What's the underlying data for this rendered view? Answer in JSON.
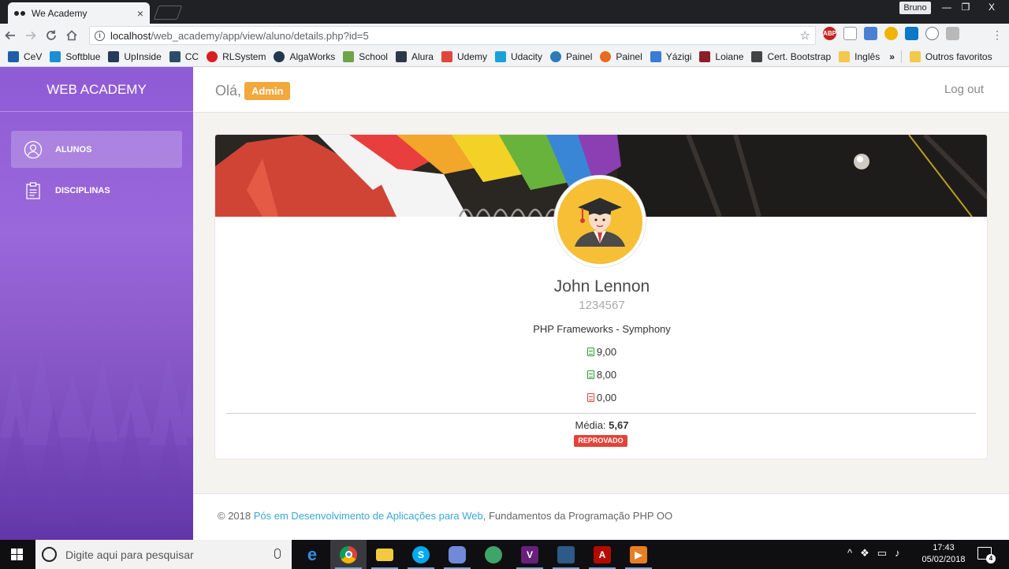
{
  "browser": {
    "tab_title": "We Academy",
    "tab_close": "×",
    "user_name": "Bruno",
    "window_min": "—",
    "window_max": "❐",
    "window_close": "X",
    "url_host": "localhost",
    "url_path": "/web_academy/app/view/aluno/details.php?id=5",
    "bookmarks": [
      "CeV",
      "Softblue",
      "UpInside",
      "CC",
      "RLSystem",
      "AlgaWorks",
      "School",
      "Alura",
      "Udemy",
      "Udacity",
      "Painel",
      "Painel",
      "Yázigi",
      "Loiane",
      "Cert. Bootstrap",
      "Inglês"
    ],
    "bookmarks_more": "»",
    "bookmarks_other": "Outros favoritos",
    "colors": {
      "titlebar": "#202124",
      "toolbar": "#f1f3f4"
    }
  },
  "sidebar": {
    "brand": "WEB ACADEMY",
    "items": [
      {
        "label": "ALUNOS",
        "icon": "user-circle-icon",
        "active": true
      },
      {
        "label": "DISCIPLINAS",
        "icon": "clipboard-icon",
        "active": false
      }
    ],
    "colors": {
      "top": "#8f5bd6",
      "bottom": "#6b3fb2"
    }
  },
  "header": {
    "greeting": "Olá,",
    "user_badge": "Admin",
    "logout": "Log out"
  },
  "student": {
    "name": "John Lennon",
    "registration": "1234567",
    "course": "PHP Frameworks - Symphony",
    "grades": [
      {
        "value": "9,00",
        "status": "ok"
      },
      {
        "value": "8,00",
        "status": "ok"
      },
      {
        "value": "0,00",
        "status": "bad"
      }
    ],
    "average_label": "Média:",
    "average_value": "5,67",
    "result": "REPROVADO",
    "avatar_icon": "graduate-avatar-icon"
  },
  "footer": {
    "copyright": "© 2018",
    "program_link": "Pós em Desenvolvimento de Aplicações para Web",
    "rest": ", Fundamentos da Programação PHP OO"
  },
  "taskbar": {
    "search_placeholder": "Digite aqui para pesquisar",
    "time": "17:43",
    "date": "05/02/2018",
    "notifications": "4",
    "apps": [
      "edge-icon",
      "chrome-icon",
      "file-explorer-icon",
      "skype-icon",
      "discord-icon",
      "atom-icon",
      "visual-studio-icon",
      "mysql-workbench-icon",
      "acrobat-icon",
      "media-player-icon"
    ]
  },
  "accent_colors": {
    "admin_badge": "#f3a83b",
    "status_failed": "#e0443a",
    "grade_ok": "#2e9e2e",
    "link": "#3aa6d8"
  }
}
